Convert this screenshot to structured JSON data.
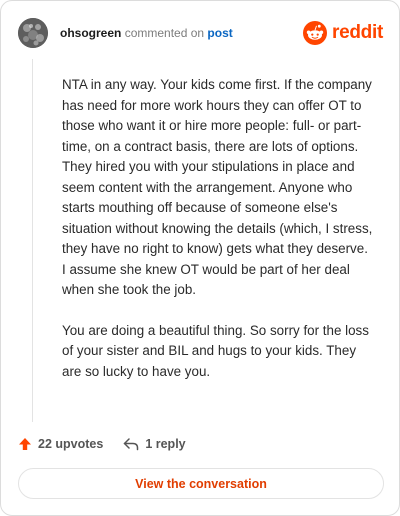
{
  "header": {
    "username": "ohsogreen",
    "action_text": "commented on",
    "post_link": "post",
    "brand_name": "reddit"
  },
  "comment": {
    "paragraphs": [
      "NTA in any way. Your kids come first. If the company has need for more work hours they can offer OT to those who want it or hire more people: full- or part-time, on a contract basis, there are lots of options. They hired you with your stipulations in place and seem content with the arrangement. Anyone who starts mouthing off because of someone else's situation without knowing the details (which, I stress, they have no right to know) gets what they deserve. I assume she knew OT would be part of her deal when she took the job.",
      "You are doing a beautiful thing. So sorry for the loss of your sister and BIL and hugs to your kids. They are so lucky to have you."
    ]
  },
  "actions": {
    "upvotes_label": "22 upvotes",
    "reply_label": "1 reply"
  },
  "cta": {
    "label": "View the conversation"
  },
  "icons": {
    "avatar": "avatar-image",
    "brand": "reddit-logo-icon",
    "upvote": "upvote-arrow-icon",
    "reply": "reply-arrow-icon"
  },
  "colors": {
    "brand": "#ff4500",
    "link": "#0a66c2",
    "cta_text": "#e13d00"
  }
}
